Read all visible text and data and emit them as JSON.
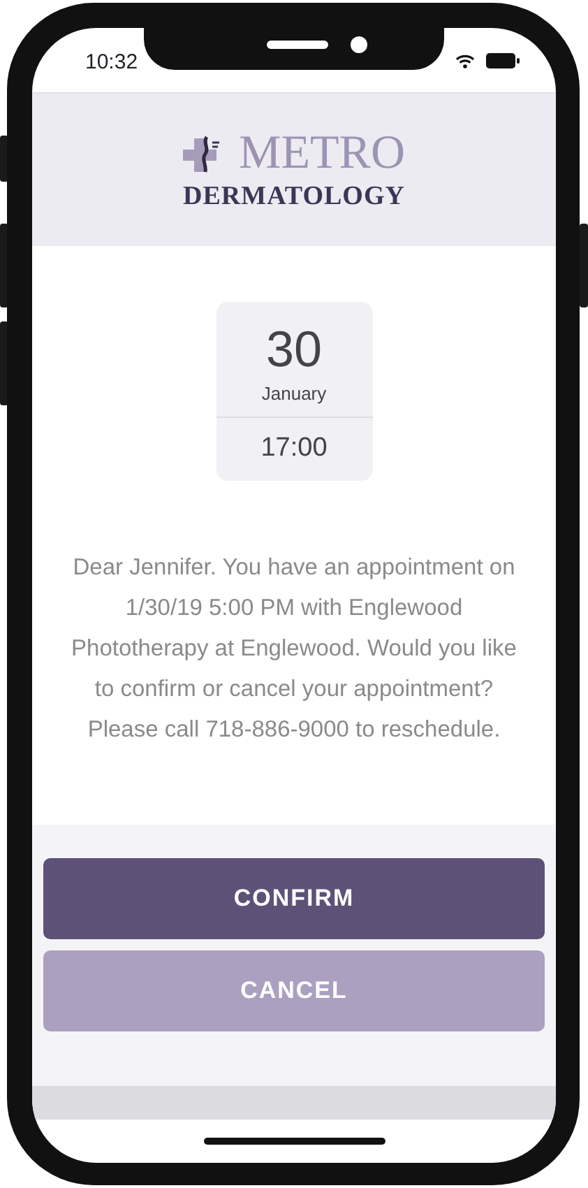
{
  "status_bar": {
    "time": "10:32"
  },
  "header": {
    "logo_line_1": "METRO",
    "logo_line_2": "DERMATOLOGY"
  },
  "appointment": {
    "day": "30",
    "month": "January",
    "time": "17:00"
  },
  "message": "Dear Jennifer. You have an appointment on 1/30/19 5:00 PM with Englewood Phototherapy at Englewood. Would you like to confirm or cancel your appointment? Please call 718-886-9000 to reschedule.",
  "buttons": [
    {
      "label": "CONFIRM",
      "kind": "primary"
    },
    {
      "label": "CANCEL",
      "kind": "secondary"
    }
  ]
}
